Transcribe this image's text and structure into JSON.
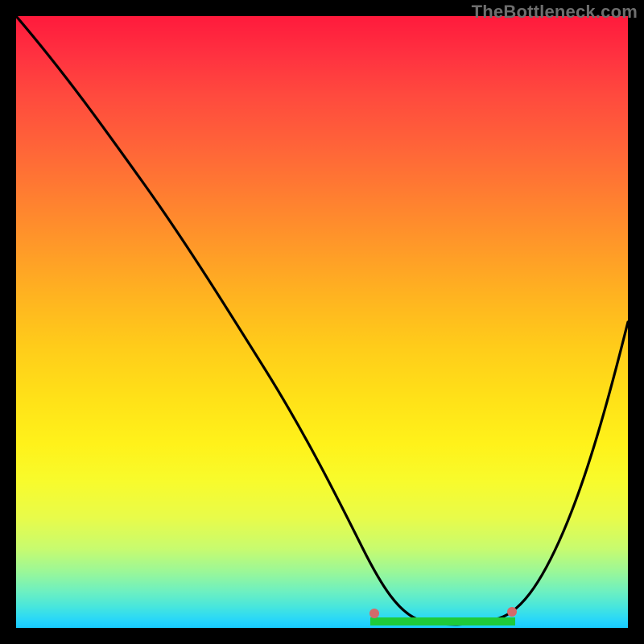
{
  "watermark": "TheBottleneck.com",
  "chart_data": {
    "type": "line",
    "title": "",
    "xlabel": "",
    "ylabel": "",
    "xlim": [
      0,
      100
    ],
    "ylim": [
      0,
      100
    ],
    "grid": false,
    "series": [
      {
        "name": "bottleneck-curve",
        "color": "#000000",
        "x": [
          0,
          6,
          12,
          18,
          24,
          30,
          36,
          42,
          48,
          54,
          58,
          62,
          66,
          70,
          74,
          78,
          82,
          88,
          94,
          100
        ],
        "values": [
          100,
          94,
          88,
          80,
          72,
          64,
          56,
          48,
          39,
          29,
          22,
          15,
          8,
          4,
          2,
          2,
          5,
          15,
          30,
          50
        ]
      }
    ],
    "optimal_band": {
      "x_start": 58,
      "x_end": 82,
      "color": "#1ecb3a"
    },
    "markers": [
      {
        "name": "curve-marker-left",
        "x": 58,
        "y": 4,
        "color": "#d46a6a"
      },
      {
        "name": "curve-marker-right",
        "x": 82,
        "y": 4,
        "color": "#d46a6a"
      }
    ],
    "background_gradient": {
      "top": "#ff1a3c",
      "mid": "#ffe018",
      "bottom": "#18ccff"
    }
  }
}
